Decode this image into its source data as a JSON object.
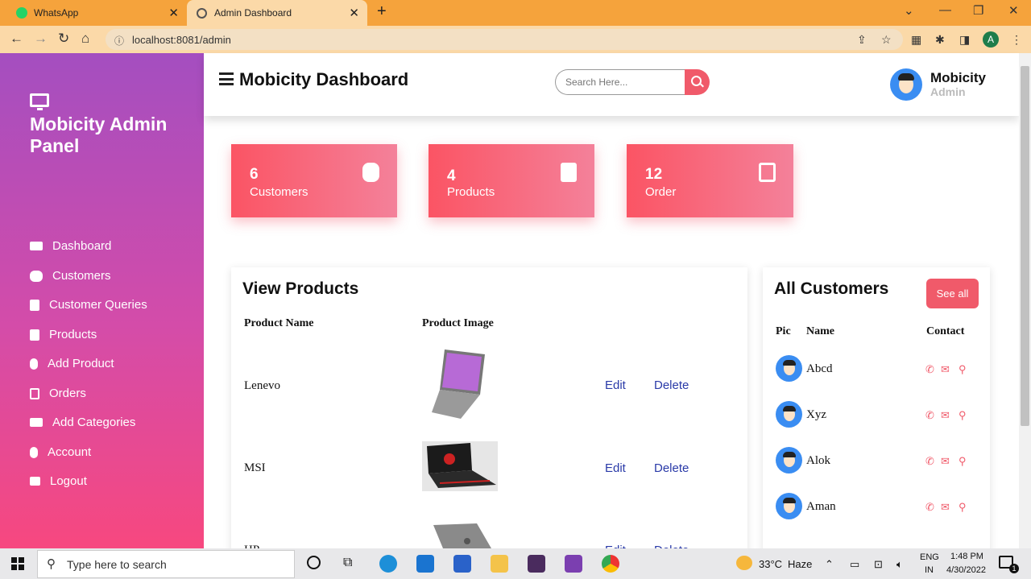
{
  "browser": {
    "tabs": [
      {
        "title": "WhatsApp"
      },
      {
        "title": "Admin Dashboard"
      }
    ],
    "url": "localhost:8081/admin",
    "profile_initial": "A"
  },
  "sidebar": {
    "title": "Mobicity Admin Panel",
    "items": [
      {
        "label": "Dashboard",
        "icon": "monitor-icon"
      },
      {
        "label": "Customers",
        "icon": "users-icon"
      },
      {
        "label": "Customer Queries",
        "icon": "file-icon"
      },
      {
        "label": "Products",
        "icon": "file-icon"
      },
      {
        "label": "Add Product",
        "icon": "user-icon"
      },
      {
        "label": "Orders",
        "icon": "pdf-icon"
      },
      {
        "label": "Add Categories",
        "icon": "money-icon"
      },
      {
        "label": "Account",
        "icon": "user-icon"
      },
      {
        "label": "Logout",
        "icon": "sign-out-icon"
      }
    ]
  },
  "header": {
    "title": "Mobicity Dashboard",
    "search_placeholder": "Search Here...",
    "user_name": "Mobicity",
    "user_role": "Admin"
  },
  "cards": [
    {
      "count": "6",
      "label": "Customers",
      "icon": "users-icon"
    },
    {
      "count": "4",
      "label": "Products",
      "icon": "file-icon"
    },
    {
      "count": "12",
      "label": "Order",
      "icon": "pdf-icon"
    }
  ],
  "products": {
    "title": "View Products",
    "columns": [
      "Product Name",
      "Product Image"
    ],
    "rows": [
      {
        "name": "Lenevo",
        "edit": "Edit",
        "delete": "Delete"
      },
      {
        "name": "MSI",
        "edit": "Edit",
        "delete": "Delete"
      },
      {
        "name": "HP",
        "edit": "Edit",
        "delete": "Delete"
      }
    ]
  },
  "customers": {
    "title": "All Customers",
    "see_all": "See all",
    "columns": [
      "Pic",
      "Name",
      "Contact"
    ],
    "rows": [
      {
        "name": "Abcd"
      },
      {
        "name": "Xyz"
      },
      {
        "name": "Alok"
      },
      {
        "name": "Aman"
      }
    ]
  },
  "taskbar": {
    "search_placeholder": "Type here to search",
    "weather_temp": "33°C",
    "weather_desc": "Haze",
    "lang_top": "ENG",
    "lang_bottom": "IN",
    "time": "1:48 PM",
    "date": "4/30/2022",
    "notification_count": "1"
  },
  "colors": {
    "accent": "#f05a6a",
    "tab_bar": "#f5a33c",
    "sidebar_top": "#a44ec0",
    "sidebar_bottom": "#f7487f",
    "link": "#2a3aa8"
  }
}
